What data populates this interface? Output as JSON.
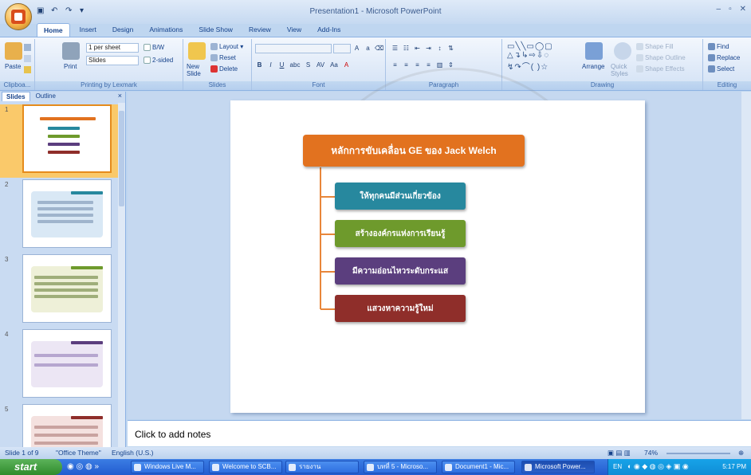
{
  "window": {
    "title": "Presentation1 - Microsoft PowerPoint",
    "controls": [
      "–",
      "▫",
      "✕"
    ]
  },
  "ribbon_tabs": [
    {
      "label": "Home",
      "active": true
    },
    {
      "label": "Insert"
    },
    {
      "label": "Design"
    },
    {
      "label": "Animations"
    },
    {
      "label": "Slide Show"
    },
    {
      "label": "Review"
    },
    {
      "label": "View"
    },
    {
      "label": "Add-Ins"
    }
  ],
  "ribbon": {
    "clipboard": {
      "paste": "Paste",
      "label": "Clipboa..."
    },
    "printing": {
      "print": "Print",
      "handout": "1 per sheet",
      "slides": "Slides",
      "bw": "B/W",
      "twosided": "2-sided",
      "label": "Printing by Lexmark"
    },
    "slides": {
      "new_slide": "New Slide",
      "layout": "Layout",
      "reset": "Reset",
      "delete": "Delete",
      "label": "Slides"
    },
    "font": {
      "label": "Font",
      "bold": "B",
      "italic": "I",
      "underline": "U",
      "abc": "abc",
      "s": "S",
      "av": "AV",
      "aa": "Aa",
      "a": "A"
    },
    "paragraph": {
      "label": "Paragraph"
    },
    "drawing": {
      "arrange": "Arrange",
      "quick_styles": "Quick Styles",
      "shape_fill": "Shape Fill",
      "shape_outline": "Shape Outline",
      "shape_effects": "Shape Effects",
      "label": "Drawing"
    },
    "editing": {
      "find": "Find",
      "replace": "Replace",
      "select": "Select",
      "label": "Editing"
    }
  },
  "pane_tabs": {
    "slides": "Slides",
    "outline": "Outline"
  },
  "thumbnails": [
    {
      "number": "1",
      "selected": true
    },
    {
      "number": "2"
    },
    {
      "number": "3"
    },
    {
      "number": "4"
    },
    {
      "number": "5"
    }
  ],
  "slide": {
    "title": "หลักการขับเคลื่อน GE ของ Jack Welch",
    "items": [
      {
        "text": "ให้ทุกคนมีส่วนเกี่ยวข้อง",
        "color": "#27889e"
      },
      {
        "text": "สร้างองค์กรแห่งการเรียนรู้",
        "color": "#6e9a2c"
      },
      {
        "text": "มีความอ่อนไหวระดับกระแส",
        "color": "#5b3e7e"
      },
      {
        "text": "แสวงหาความรู้ใหม่",
        "color": "#8f2e2a"
      }
    ],
    "title_color": "#e2721f"
  },
  "notes": {
    "placeholder": "Click to add notes"
  },
  "status": {
    "slide": "Slide 1 of 9",
    "theme": "\"Office Theme\"",
    "language": "English (U.S.)",
    "zoom": "74%"
  },
  "taskbar": {
    "start": "start",
    "items": [
      {
        "label": "Windows Live M..."
      },
      {
        "label": "Welcome to SCB..."
      },
      {
        "label": "รายงาน"
      },
      {
        "label": "บทที่ 5 - Microso..."
      },
      {
        "label": "Document1 - Mic..."
      },
      {
        "label": "Microsoft Power...",
        "active": true
      }
    ],
    "lang": "EN",
    "clock": "5:17 PM"
  }
}
